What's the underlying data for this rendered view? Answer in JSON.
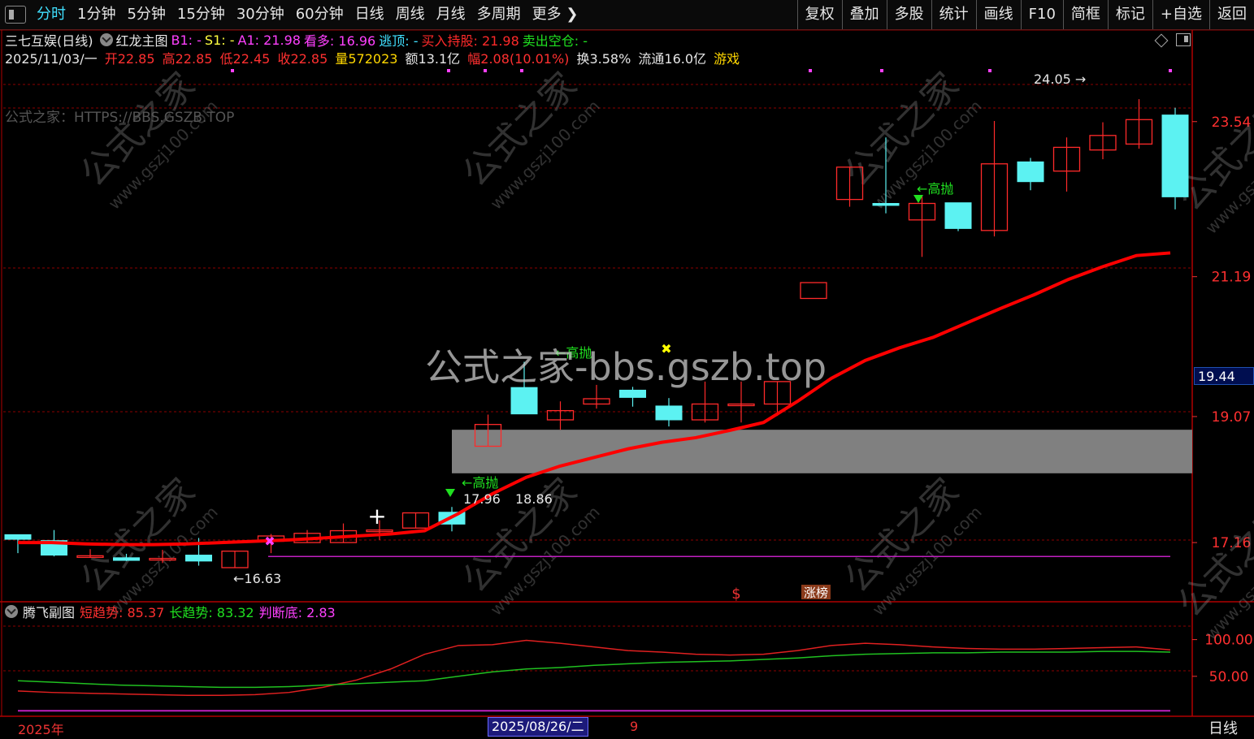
{
  "toolbar": {
    "tabs": [
      "分时",
      "1分钟",
      "5分钟",
      "15分钟",
      "30分钟",
      "60分钟",
      "日线",
      "周线",
      "月线",
      "多周期",
      "更多"
    ],
    "active_tab": "分时",
    "right_buttons": [
      "复权",
      "叠加",
      "多股",
      "统计",
      "画线",
      "F10",
      "简框",
      "标记",
      "+自选",
      "返回"
    ]
  },
  "header": {
    "stock": "三七互娱(日线)",
    "indicator": "红龙主图",
    "b1": "B1: -",
    "s1": "S1: -",
    "a1": "A1: 21.98",
    "kanduo": "看多: 16.96",
    "taoding": "逃顶: -",
    "buy_hold": "买入持股: 21.98",
    "sell_empty": "卖出空仓: -"
  },
  "quote": {
    "date": "2025/11/03/一",
    "open": "开22.85",
    "high": "高22.85",
    "low": "低22.45",
    "close": "收22.85",
    "volume": "量572023",
    "amount": "额13.1亿",
    "change": "幅2.08(10.01%)",
    "turnover": "换3.58%",
    "float": "流通16.0亿",
    "game": "游戏"
  },
  "overlay_text": {
    "site_label": "公式之家：HTTPS://BBS.GSZB.TOP",
    "center_watermark": "公式之家-bbs.gszb.top",
    "watermark_cn": "公式之家",
    "watermark_url": "www.gszj100.com"
  },
  "annotations": {
    "high_label": "24.05",
    "low_label": "16.63",
    "label_1796": "17.96",
    "label_1886": "18.86",
    "gaopao": "高抛",
    "dollar": "$",
    "zhangbang": "涨榜"
  },
  "sub_chart": {
    "name": "腾飞副图",
    "short_trend": "短趋势: 85.37",
    "long_trend": "长趋势: 83.32",
    "bottom": "判断底: 2.83"
  },
  "date_axis": {
    "year": "2025年",
    "cursor_date": "2025/08/26/二",
    "marker": "9",
    "mode": "日线"
  },
  "current_price_tag": "19.44",
  "colors": {
    "up": "#ff2a2a",
    "down": "#5cf2f2",
    "ma": "#ff0000",
    "short_trend": "#e02020",
    "long_trend": "#20c020",
    "bottom_line": "#c020c0",
    "grid": "#8b0000"
  },
  "chart_data": {
    "type": "candlestick",
    "y_ticks": [
      23.54,
      21.19,
      19.07,
      17.16
    ],
    "ylim": [
      16.3,
      24.3
    ],
    "zone": [
      18.21,
      18.87
    ],
    "candles": [
      {
        "o": 17.28,
        "c": 17.21,
        "h": 17.21,
        "l": 17.0
      },
      {
        "o": 17.19,
        "c": 16.97,
        "h": 17.35,
        "l": 16.95
      },
      {
        "o": 16.95,
        "c": 16.96,
        "h": 17.06,
        "l": 16.94
      },
      {
        "o": 16.93,
        "c": 16.89,
        "h": 16.99,
        "l": 16.88
      },
      {
        "o": 16.92,
        "c": 16.92,
        "h": 17.05,
        "l": 16.85
      },
      {
        "o": 16.97,
        "c": 16.88,
        "h": 17.23,
        "l": 16.81
      },
      {
        "o": 16.78,
        "c": 17.03,
        "h": 17.03,
        "l": 16.78
      },
      {
        "o": 17.18,
        "c": 17.26,
        "h": 17.29,
        "l": 17.0
      },
      {
        "o": 17.16,
        "c": 17.3,
        "h": 17.35,
        "l": 17.16
      },
      {
        "o": 17.16,
        "c": 17.34,
        "h": 17.45,
        "l": 17.16
      },
      {
        "o": 17.35,
        "c": 17.35,
        "h": 17.5,
        "l": 17.2
      },
      {
        "o": 17.38,
        "c": 17.61,
        "h": 17.61,
        "l": 17.38
      },
      {
        "o": 17.62,
        "c": 17.44,
        "h": 17.7,
        "l": 17.33
      },
      {
        "o": 18.62,
        "c": 18.95,
        "h": 19.1,
        "l": 18.62
      },
      {
        "o": 19.51,
        "c": 19.11,
        "h": 19.9,
        "l": 19.11
      },
      {
        "o": 19.02,
        "c": 19.16,
        "h": 19.3,
        "l": 18.87
      },
      {
        "o": 19.26,
        "c": 19.34,
        "h": 19.55,
        "l": 19.19
      },
      {
        "o": 19.47,
        "c": 19.36,
        "h": 19.52,
        "l": 19.22
      },
      {
        "o": 19.23,
        "c": 19.02,
        "h": 19.35,
        "l": 18.92
      },
      {
        "o": 19.02,
        "c": 19.26,
        "h": 19.6,
        "l": 18.98
      },
      {
        "o": 19.26,
        "c": 19.26,
        "h": 19.6,
        "l": 18.98
      },
      {
        "o": 19.26,
        "c": 19.6,
        "h": 19.6,
        "l": 19.08
      },
      {
        "o": 20.86,
        "c": 21.1,
        "h": 21.08,
        "l": 21.08
      },
      {
        "o": 22.36,
        "c": 22.85,
        "h": 22.85,
        "l": 22.25
      },
      {
        "o": 22.3,
        "c": 22.27,
        "h": 23.3,
        "l": 22.15
      },
      {
        "o": 22.05,
        "c": 22.3,
        "h": 22.42,
        "l": 21.49
      },
      {
        "o": 22.31,
        "c": 21.92,
        "h": 22.31,
        "l": 21.88
      },
      {
        "o": 21.89,
        "c": 22.9,
        "h": 23.55,
        "l": 21.8
      },
      {
        "o": 22.93,
        "c": 22.63,
        "h": 22.99,
        "l": 22.5
      },
      {
        "o": 22.79,
        "c": 23.15,
        "h": 23.3,
        "l": 22.48
      },
      {
        "o": 23.11,
        "c": 23.33,
        "h": 23.53,
        "l": 22.97
      },
      {
        "o": 23.2,
        "c": 23.57,
        "h": 23.88,
        "l": 23.13
      },
      {
        "o": 23.64,
        "c": 22.4,
        "h": 23.75,
        "l": 22.21
      }
    ],
    "ma_line": [
      17.16,
      17.16,
      17.14,
      17.13,
      17.13,
      17.14,
      17.16,
      17.18,
      17.2,
      17.23,
      17.26,
      17.29,
      17.34,
      17.6,
      17.9,
      18.15,
      18.32,
      18.45,
      18.58,
      18.68,
      18.75,
      18.86,
      18.98,
      19.3,
      19.65,
      19.92,
      20.11,
      20.27,
      20.49,
      20.71,
      20.92,
      21.15,
      21.34,
      21.51,
      21.55
    ],
    "purple_line_level": 16.95,
    "sub_ylim": [
      0,
      125
    ],
    "sub_y_ticks": [
      100.0,
      50.0
    ],
    "short_trend_series": [
      30,
      28,
      27,
      26,
      25,
      24,
      24,
      25,
      28,
      35,
      45,
      60,
      80,
      92,
      93,
      99,
      95,
      90,
      85,
      83,
      80,
      79,
      80,
      85,
      92,
      95,
      93,
      90,
      88,
      87,
      87,
      88,
      89,
      90,
      86
    ],
    "long_trend_series": [
      44,
      42,
      40,
      38,
      37,
      36,
      35,
      35,
      36,
      38,
      40,
      42,
      44,
      50,
      56,
      60,
      62,
      65,
      67,
      69,
      70,
      71,
      73,
      75,
      78,
      80,
      81,
      82,
      82,
      83,
      83,
      83,
      84,
      84,
      83
    ],
    "bottom_series_level": 3
  }
}
